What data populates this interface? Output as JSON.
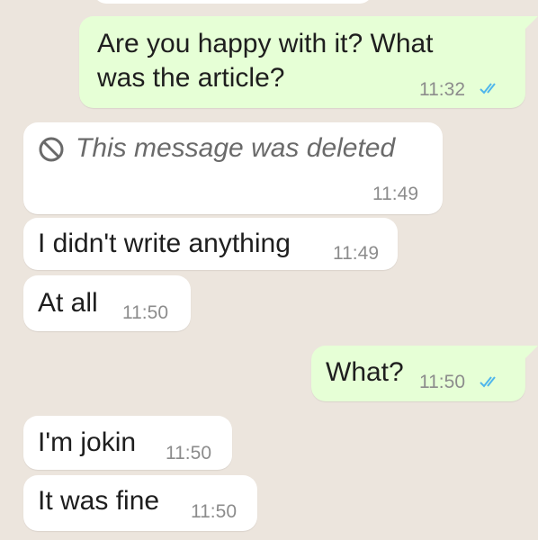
{
  "conversation": {
    "messages": [
      {
        "id": "m1",
        "direction": "outgoing",
        "lines": [
          "Are you happy with it?  What",
          "was the article?"
        ],
        "time": "11:32",
        "status": "read-double-check"
      },
      {
        "id": "m2",
        "direction": "incoming",
        "deleted": true,
        "text": "This message was deleted",
        "icon": "blocked-icon",
        "time": "11:49"
      },
      {
        "id": "m3",
        "direction": "incoming",
        "text": "I didn't write anything",
        "time": "11:49"
      },
      {
        "id": "m4",
        "direction": "incoming",
        "text": "At all",
        "time": "11:50"
      },
      {
        "id": "m5",
        "direction": "outgoing",
        "text": "What?",
        "time": "11:50",
        "status": "read-double-check"
      },
      {
        "id": "m6",
        "direction": "incoming",
        "text": "I'm jokin",
        "time": "11:50"
      },
      {
        "id": "m7",
        "direction": "incoming",
        "text": "It was fine",
        "time": "11:50"
      }
    ]
  },
  "colors": {
    "background": "#ECE5DD",
    "incoming_bubble": "#FFFFFF",
    "outgoing_bubble": "#E6FFD6",
    "read_tick": "#4FB6EC",
    "timestamp": "#8C8C8C"
  }
}
